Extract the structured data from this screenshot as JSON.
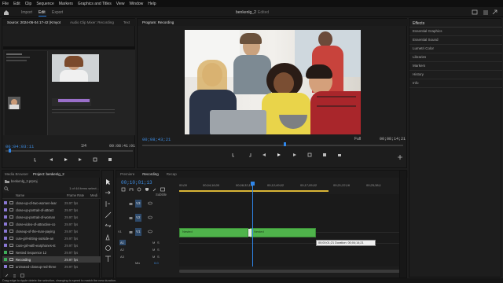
{
  "menu": [
    "File",
    "Edit",
    "Clip",
    "Sequence",
    "Markers",
    "Graphics and Titles",
    "View",
    "Window",
    "Help"
  ],
  "workspace": {
    "tabs": [
      "Import",
      "Edit",
      "Export"
    ],
    "active_tab": "Edit",
    "project_title": "benkenlg_2",
    "status": "Edited"
  },
  "source_monitor": {
    "tabs": [
      "Source: 2024-06-04 17-42 (Kmyot",
      "Audio Clip Mixer: Recording",
      "Text"
    ],
    "timecode_left": "00:04:03:11",
    "fraction": "1/4",
    "timecode_right": "00:08:41:01"
  },
  "program_monitor": {
    "tab": "Program: Recording",
    "timecode_left": "00;08;43;21",
    "fit": "Full",
    "timecode_right": "00;08;14;21"
  },
  "effects_panel": {
    "title": "Effects",
    "items": [
      "Essential Graphics",
      "Essential Sound",
      "Lumetri Color",
      "Libraries",
      "Markers",
      "History",
      "Info"
    ]
  },
  "project_panel": {
    "tabs": [
      "Media Browser",
      "Project: benkenlg_2"
    ],
    "project_file": "benkenlg_2.prproj",
    "selection_info": "1 of 44 items select...",
    "columns": [
      "Name",
      "Frame Rate",
      "Medi"
    ],
    "items": [
      {
        "name": "close-up-of-two-women-lear",
        "rate": "29.97 fps",
        "color": "#8a78d4"
      },
      {
        "name": "close-up-portrait-of-attract",
        "rate": "29.97 fps",
        "color": "#8a78d4"
      },
      {
        "name": "close-up-portrait-of-woman",
        "rate": "29.97 fps",
        "color": "#8a78d4"
      },
      {
        "name": "close-video-of-attractive-co",
        "rate": "29.97 fps",
        "color": "#8a78d4"
      },
      {
        "name": "closeup-of-the-man-paying",
        "rate": "29.97 fps",
        "color": "#8a78d4"
      },
      {
        "name": "cute-girl-sitting-outside-an",
        "rate": "29.97 fps",
        "color": "#8a78d4"
      },
      {
        "name": "Cute-girl-with-earphones-st",
        "rate": "29.97 fps",
        "color": "#8a78d4"
      },
      {
        "name": "Nested Sequence 12",
        "rate": "29.97 fps",
        "color": "#3fae5a"
      },
      {
        "name": "Recording",
        "rate": "29.97 fps",
        "color": "#3fae5a"
      },
      {
        "name": "animated-closeup-red-three",
        "rate": "29.97 fps",
        "color": "#8a78d4"
      }
    ]
  },
  "timeline": {
    "tabs": [
      "Premiere",
      "Recording",
      "Recap"
    ],
    "active_tab": "Recording",
    "timecode": "00;10;01;13",
    "subtitle_label": "Subtitle",
    "ruler": [
      "00;00",
      "00;04;16;00",
      "00;08;32;16",
      "00;12;49;02",
      "00;17;05;02",
      "00;21;22;16",
      "00;25;38;1"
    ],
    "tracks_video": [
      "V3",
      "V2",
      "V1"
    ],
    "tracks_audio": [
      "A1",
      "A2",
      "A3"
    ],
    "mix_label": "Mix",
    "mix_value": "0.0",
    "clip1_label": "Nested",
    "clip2_label": "Nested",
    "tooltip": "00;00;01;21 Duration: 00;04;14;21"
  },
  "status_bar": "Drag edge to ripple delete the selection, changing to speed to match the new duration.",
  "colors": {
    "accent": "#2f86ea",
    "clip_green": "#4fb34b",
    "label_purple": "#8a78d4",
    "timecode_blue": "#3e8ee5"
  }
}
